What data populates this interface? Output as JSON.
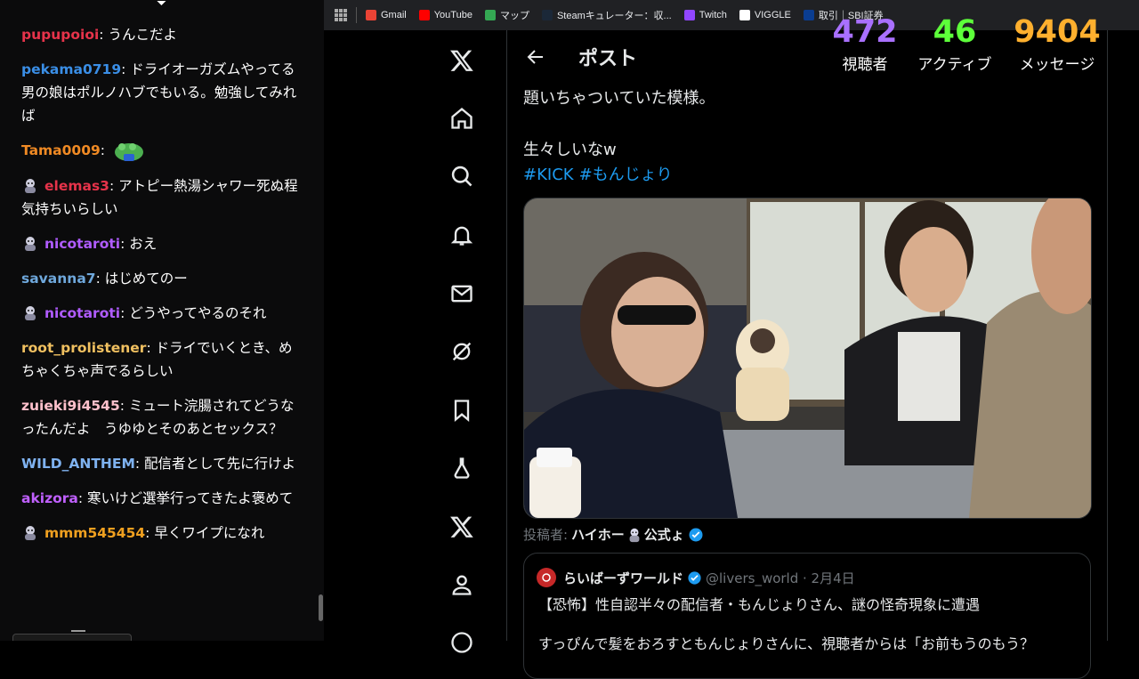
{
  "colors": {
    "accent": "#1d9bf0",
    "viewers": "#a970ff",
    "active": "#5dff3a",
    "messages": "#ffb02e"
  },
  "chat": {
    "messages": [
      {
        "user": "pupupoioi",
        "color": "#e6334a",
        "text": "うんこだよ",
        "badge": false
      },
      {
        "user": "pekama0719",
        "color": "#3a8ee6",
        "text": "ドライオーガズムやってる男の娘はポルノハブでもいる。勉強してみれば",
        "badge": false
      },
      {
        "user": "Tama0009",
        "color": "#f08a24",
        "text": "",
        "badge": false,
        "emote": "frog-emote"
      },
      {
        "user": "elemas3",
        "color": "#e6334a",
        "text": "アトピー熱湯シャワー死ぬ程気持ちいらしい",
        "badge": true
      },
      {
        "user": "nicotaroti",
        "color": "#b05cff",
        "text": "おえ",
        "badge": true
      },
      {
        "user": "savanna7",
        "color": "#6fa8dc",
        "text": "はじめてのー",
        "badge": false
      },
      {
        "user": "nicotaroti",
        "color": "#b05cff",
        "text": "どうやってやるのそれ",
        "badge": true
      },
      {
        "user": "root_prolistener",
        "color": "#f0c060",
        "text": "ドライでいくとき、めちゃくちゃ声でるらしい",
        "badge": false
      },
      {
        "user": "zuieki9i4545",
        "color": "#ffc0cb",
        "text": "ミュート浣腸されてどうなったんだよ　うゆゆとそのあとセックス？",
        "badge": false
      },
      {
        "user": "WILD_ANTHEM",
        "color": "#7fb2f0",
        "text": "配信者として先に行けよ",
        "badge": false
      },
      {
        "user": "akizora",
        "color": "#c060ff",
        "text": "寒いけど選挙行ってきたよ褒めて",
        "badge": false
      },
      {
        "user": "mmm545454",
        "color": "#f0a020",
        "text": "早くワイプになれ",
        "badge": true
      }
    ]
  },
  "bookmarks": [
    {
      "label": "Gmail",
      "icon": "gmail-icon",
      "color": "#ea4335"
    },
    {
      "label": "YouTube",
      "icon": "youtube-icon",
      "color": "#ff0000"
    },
    {
      "label": "マップ",
      "icon": "maps-icon",
      "color": "#34a853"
    },
    {
      "label": "Steamキュレーター：収...",
      "icon": "steam-icon",
      "color": "#1b2838"
    },
    {
      "label": "Twitch",
      "icon": "twitch-icon",
      "color": "#9146ff"
    },
    {
      "label": "VIGGLE",
      "icon": "viggle-icon",
      "color": "#ffffff"
    },
    {
      "label": "取引｜SBI証券",
      "icon": "sbi-icon",
      "color": "#0a3d91"
    }
  ],
  "stats": {
    "viewers": {
      "value": "472",
      "label": "視聴者"
    },
    "active": {
      "value": "46",
      "label": "アクティブ"
    },
    "messages": {
      "value": "9404",
      "label": "メッセージ"
    }
  },
  "nav": [
    "x-logo-icon",
    "home-icon",
    "search-icon",
    "notifications-icon",
    "messages-icon",
    "grok-icon",
    "bookmarks-icon",
    "communities-icon",
    "premium-icon",
    "profile-icon",
    "more-icon"
  ],
  "post": {
    "header_title": "ポスト",
    "text_line1": "題いちゃついていた模様。",
    "text_line2": "生々しいなw",
    "hashtags": [
      "#KICK",
      "#もんじょり"
    ],
    "poster_prefix": "投稿者:",
    "poster_name_part1": "ハイホー",
    "poster_name_part2": "公式ょ",
    "quote": {
      "name": "らいばーずワールド",
      "handle": "@livers_world · 2月4日",
      "text": "【恐怖】性自認半々の配信者・もんじょりさん、謎の怪奇現象に遭遇",
      "text2": "すっぴんで髪をおろすともんじょりさんに、視聴者からは「お前もうのもう？"
    }
  }
}
